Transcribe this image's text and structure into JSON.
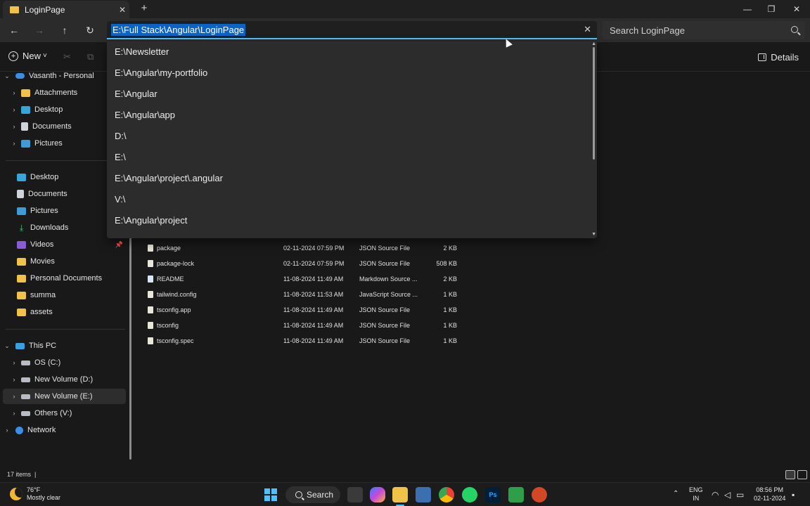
{
  "window": {
    "tab_title": "LoginPage",
    "tab_close": "✕",
    "new_tab": "+",
    "minimize": "—",
    "maximize": "❐",
    "close": "✕"
  },
  "nav": {
    "back": "←",
    "forward": "→",
    "up": "↑",
    "refresh": "↻",
    "address": "E:\\Full Stack\\Angular\\LoginPage",
    "clear": "✕",
    "search_placeholder": "Search LoginPage"
  },
  "command_bar": {
    "new_label": "New",
    "new_chevron": "˅",
    "cut": "✂",
    "copy": "⧉",
    "details_label": "Details"
  },
  "sidebar": {
    "onedrive": "Vasanth - Personal",
    "onedrive_items": [
      "Attachments",
      "Desktop",
      "Documents",
      "Pictures"
    ],
    "quick_access": [
      "Desktop",
      "Documents",
      "Pictures",
      "Downloads",
      "Videos",
      "Movies",
      "Personal Documents",
      "summa",
      "assets"
    ],
    "this_pc": "This PC",
    "drives": [
      "OS (C:)",
      "New Volume (D:)",
      "New Volume (E:)",
      "Others (V:)"
    ],
    "network": "Network"
  },
  "autocomplete": {
    "items": [
      "E:\\Newsletter",
      "E:\\Angular\\my-portfolio",
      "E:\\Angular",
      "E:\\Angular\\app",
      "D:\\",
      "E:\\",
      "E:\\Angular\\project\\.angular",
      "V:\\",
      "E:\\Angular\\project"
    ]
  },
  "files": [
    {
      "name": "package",
      "date": "02-11-2024 07:59 PM",
      "type": "JSON Source File",
      "size": "2 KB"
    },
    {
      "name": "package-lock",
      "date": "02-11-2024 07:59 PM",
      "type": "JSON Source File",
      "size": "508 KB"
    },
    {
      "name": "README",
      "date": "11-08-2024 11:49 AM",
      "type": "Markdown Source ...",
      "size": "2 KB"
    },
    {
      "name": "tailwind.config",
      "date": "11-08-2024 11:53 AM",
      "type": "JavaScript Source ...",
      "size": "1 KB"
    },
    {
      "name": "tsconfig.app",
      "date": "11-08-2024 11:49 AM",
      "type": "JSON Source File",
      "size": "1 KB"
    },
    {
      "name": "tsconfig",
      "date": "11-08-2024 11:49 AM",
      "type": "JSON Source File",
      "size": "1 KB"
    },
    {
      "name": "tsconfig.spec",
      "date": "11-08-2024 11:49 AM",
      "type": "JSON Source File",
      "size": "1 KB"
    }
  ],
  "status": {
    "item_count": "17 items",
    "separator": "|"
  },
  "taskbar": {
    "temperature": "76°F",
    "weather": "Mostly clear",
    "search_label": "Search",
    "ps_label": "Ps",
    "language_top": "ENG",
    "language_bottom": "IN",
    "time": "08:56 PM",
    "date": "02-11-2024"
  },
  "colors": {
    "accent": "#4cc2ff",
    "selection": "#0a64c8",
    "folder": "#f0c24a"
  }
}
